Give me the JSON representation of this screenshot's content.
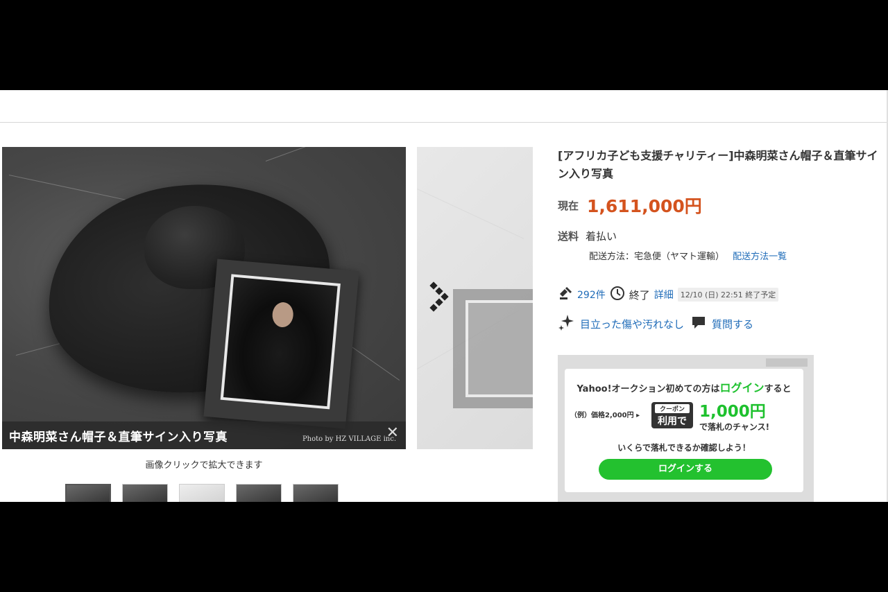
{
  "gallery": {
    "caption": "中森明菜さん帽子＆直筆サイン入り写真",
    "credit": "Photo by HZ VILLAGE inc.",
    "close_symbol": "✕",
    "zoom_hint": "画像クリックで拡大できます",
    "thumbnail_count": 5
  },
  "item": {
    "title": "[アフリカ子ども支援チャリティー]中森明菜さん帽子＆直筆サイン入り写真",
    "price_label": "現在",
    "price": "1,611,000円",
    "shipping_label": "送料",
    "shipping_value": "着払い",
    "shipping_method": "配送方法：宅急便（ヤマト運輸）",
    "shipping_list_link": "配送方法一覧",
    "bids": "292件",
    "status": "終了",
    "detail_link": "詳細",
    "end_date": "12/10 (日) 22:51 終了予定",
    "condition": "目立った傷や汚れなし",
    "question_link": "質問する"
  },
  "coupon": {
    "line1_pre": "Yahoo!オークション初めての方は",
    "line1_login": "ログイン",
    "line1_post": "すると",
    "example": "（例）価格2,000円 ▸",
    "badge_top": "クーポン",
    "badge_main": "利用で",
    "amount": "1,000円",
    "tail": "で落札のチャンス!",
    "check": "いくらで落札できるか確認しよう！",
    "login_button": "ログインする"
  },
  "colors": {
    "price": "#d4531e",
    "link": "#1e6bb8",
    "coupon_green": "#1ec12e"
  },
  "icons": [
    "gavel-icon",
    "clock-icon",
    "sparkle-icon",
    "chat-icon",
    "next-arrow-icon",
    "close-icon"
  ]
}
